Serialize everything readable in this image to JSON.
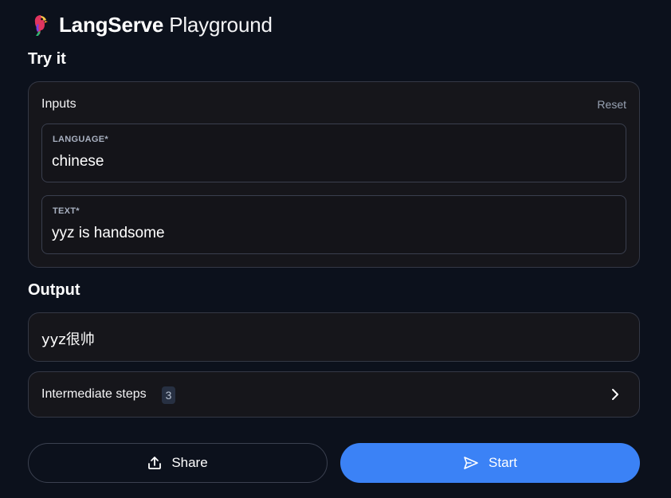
{
  "header": {
    "brand": "LangServe",
    "subtitle": "Playground",
    "logo_icon": "parrot-logo-icon"
  },
  "try_it": {
    "title": "Try it",
    "inputs_label": "Inputs",
    "reset_label": "Reset",
    "fields": [
      {
        "label": "LANGUAGE*",
        "value": "chinese"
      },
      {
        "label": "TEXT*",
        "value": "yyz is handsome"
      }
    ]
  },
  "output": {
    "title": "Output",
    "value": "yyz很帅",
    "intermediate_steps_label": "Intermediate steps",
    "intermediate_steps_count": "3",
    "expand_icon": "chevron-right-icon"
  },
  "actions": {
    "share_label": "Share",
    "share_icon": "share-upload-icon",
    "start_label": "Start",
    "start_icon": "send-icon"
  },
  "colors": {
    "background": "#0c111c",
    "card": "#16161b",
    "border": "#343845",
    "accent": "#3b82f6",
    "muted": "#98a2b3"
  }
}
